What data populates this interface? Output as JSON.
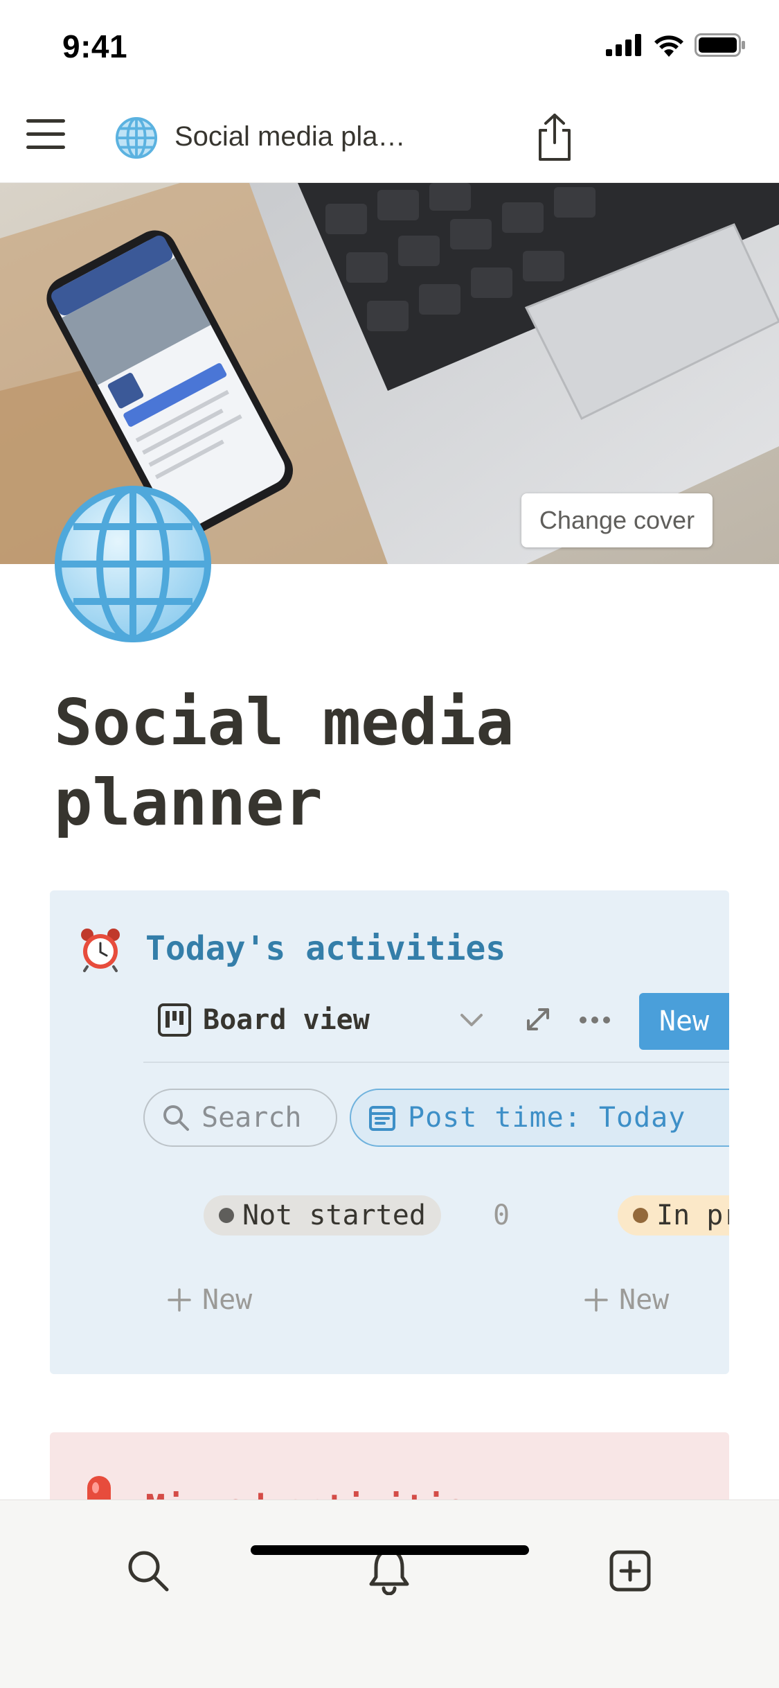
{
  "status_bar": {
    "time": "9:41"
  },
  "nav": {
    "title": "Social media pla…"
  },
  "cover": {
    "change_cover_label": "Change cover"
  },
  "page": {
    "title": "Social media planner"
  },
  "todays_activities": {
    "heading": "Today's activities",
    "view_name": "Board view",
    "new_label": "New",
    "search_label": "Search",
    "filter_label": "Post time: Today",
    "groups": [
      {
        "label": "Not started",
        "count": "0",
        "dot_color": "#5f5e5b"
      },
      {
        "label": "In progress",
        "dot_color": "#93693b"
      }
    ],
    "add_new_left": "New",
    "add_new_right": "New"
  },
  "missed_activities": {
    "heading": "Missed activities"
  },
  "colors": {
    "accent_blue": "#4a9fda",
    "callout_blue_bg": "#e7f0f7",
    "callout_red_bg": "#f8e6e6",
    "heading_blue": "#347ea9",
    "heading_red": "#d44c47"
  }
}
